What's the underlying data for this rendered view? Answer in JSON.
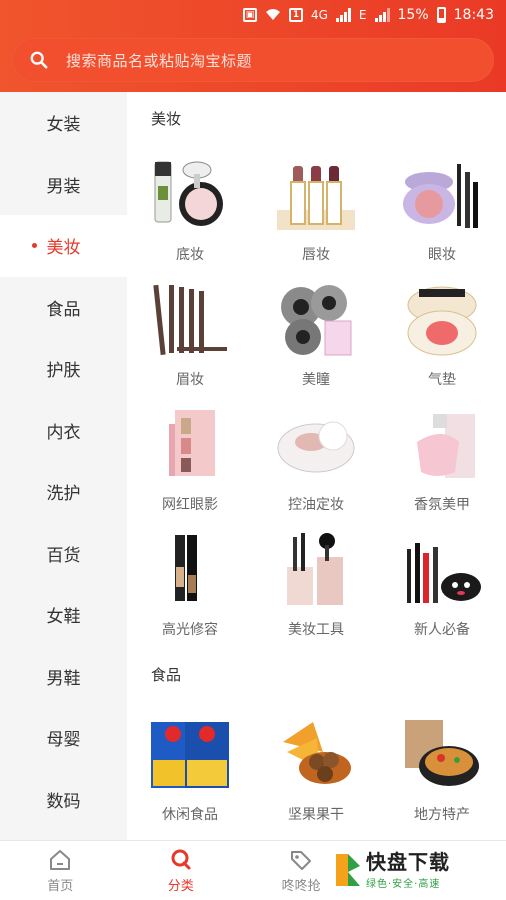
{
  "status_bar": {
    "network": "4G",
    "network2": "E",
    "battery": "15%",
    "time": "18:43"
  },
  "search": {
    "placeholder": "搜索商品名或粘贴淘宝标题"
  },
  "sidebar": {
    "items": [
      {
        "label": "女装"
      },
      {
        "label": "男装"
      },
      {
        "label": "美妆",
        "active": true
      },
      {
        "label": "食品"
      },
      {
        "label": "护肤"
      },
      {
        "label": "内衣"
      },
      {
        "label": "洗护"
      },
      {
        "label": "百货"
      },
      {
        "label": "女鞋"
      },
      {
        "label": "男鞋"
      },
      {
        "label": "母婴"
      },
      {
        "label": "数码"
      }
    ]
  },
  "sections": [
    {
      "title": "美妆",
      "items": [
        {
          "label": "底妆",
          "icon": "foundation-icon"
        },
        {
          "label": "唇妆",
          "icon": "lipstick-icon"
        },
        {
          "label": "眼妆",
          "icon": "eyeshadow-icon"
        },
        {
          "label": "眉妆",
          "icon": "eyebrow-pencil-icon"
        },
        {
          "label": "美瞳",
          "icon": "contact-lens-icon"
        },
        {
          "label": "气垫",
          "icon": "cushion-compact-icon"
        },
        {
          "label": "网红眼影",
          "icon": "eye-palette-icon"
        },
        {
          "label": "控油定妆",
          "icon": "powder-icon"
        },
        {
          "label": "香氛美甲",
          "icon": "perfume-icon"
        },
        {
          "label": "高光修容",
          "icon": "contour-stick-icon"
        },
        {
          "label": "美妆工具",
          "icon": "brush-set-icon"
        },
        {
          "label": "新人必备",
          "icon": "makeup-kit-icon"
        }
      ]
    },
    {
      "title": "食品",
      "items": [
        {
          "label": "休闲食品",
          "icon": "chips-bag-icon"
        },
        {
          "label": "坚果果干",
          "icon": "nuts-icon"
        },
        {
          "label": "地方特产",
          "icon": "noodle-bowl-icon"
        }
      ]
    }
  ],
  "bottom_nav": {
    "tabs": [
      {
        "label": "首页",
        "icon": "home-icon"
      },
      {
        "label": "分类",
        "icon": "search-icon",
        "active": true
      },
      {
        "label": "咚咚抢",
        "icon": "tag-icon"
      }
    ]
  },
  "watermark": {
    "main": "快盘下载",
    "sub": "绿色·安全·高速"
  },
  "colors": {
    "accent": "#e8372b",
    "header_start": "#f0552d",
    "header_end": "#ea3a26"
  }
}
